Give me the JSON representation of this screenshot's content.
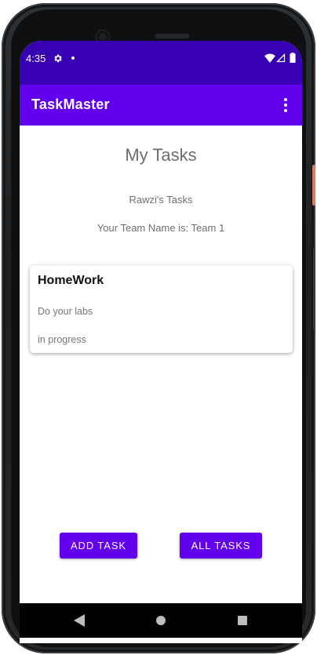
{
  "status_bar": {
    "time": "4:35",
    "icons": [
      "gear-icon",
      "notification-dot",
      "wifi-icon",
      "signal-icon",
      "battery-icon"
    ]
  },
  "app_bar": {
    "title": "TaskMaster",
    "menu_icon": "overflow-menu-icon"
  },
  "main": {
    "title": "My Tasks",
    "user_tasks": "Rawzi's Tasks",
    "team_name": "Your Team Name is: Team 1"
  },
  "tasks": [
    {
      "title": "HomeWork",
      "body": "Do your labs",
      "state": "in progress"
    }
  ],
  "buttons": {
    "add_task": "ADD TASK",
    "all_tasks": "ALL TASKS"
  },
  "nav_bar": {
    "icons": [
      "back-icon",
      "home-icon",
      "recents-icon"
    ]
  },
  "colors": {
    "status_bar": "#3700b3",
    "app_bar": "#6200ee",
    "button": "#6200ee"
  }
}
